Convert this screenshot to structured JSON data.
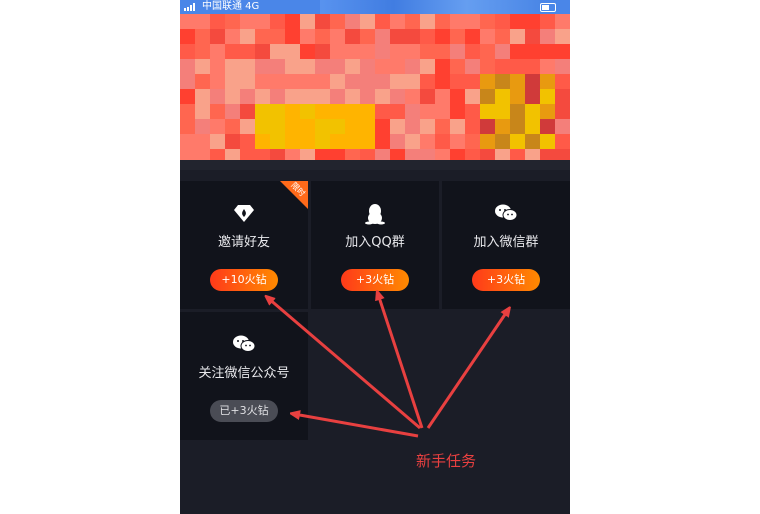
{
  "status_bar": {
    "carrier": "中国联通 4G"
  },
  "tasks": [
    {
      "title": "邀请好友",
      "reward": "+10火钻",
      "icon": "diamond-flame-icon",
      "badge": "限时",
      "done": false
    },
    {
      "title": "加入QQ群",
      "reward": "+3火钻",
      "icon": "qq-penguin-icon",
      "done": false
    },
    {
      "title": "加入微信群",
      "reward": "+3火钻",
      "icon": "wechat-icon",
      "done": false
    },
    {
      "title": "关注微信公众号",
      "reward": "已+3火钻",
      "icon": "wechat-icon",
      "done": true
    }
  ],
  "annotation": {
    "text": "新手任务",
    "color": "#e84040"
  },
  "colors": {
    "background": "#1b1d27",
    "cell": "#11131b",
    "pill_start": "#ff3a1a",
    "pill_end": "#ff8a00",
    "pill_done": "#4a4c55"
  }
}
